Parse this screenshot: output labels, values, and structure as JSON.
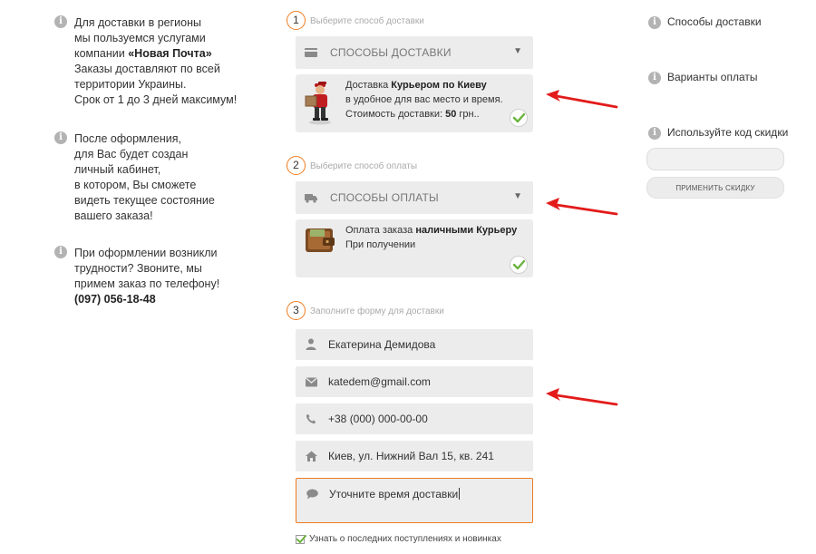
{
  "left_info": {
    "delivery": {
      "line1": "Для доставки в регионы",
      "line2": "мы пользуемся услугами",
      "line3_pre": "компании ",
      "line3_bold": "«Новая Почта»",
      "line4": "Заказы доставляют по всей",
      "line5": "территории Украины.",
      "line6": "Срок от 1 до 3 дней максимум!"
    },
    "account": {
      "line1": "После оформления,",
      "line2": "для Вас будет создан",
      "line3": "личный кабинет,",
      "line4": "в котором, Вы сможете",
      "line5": "видеть текущее состояние",
      "line6": "вашего заказа!"
    },
    "help": {
      "line1": "При оформлении возникли",
      "line2": "трудности? Звоните, мы",
      "line3": "примем заказ по телефону!",
      "phone": "(097) 056-18-48"
    }
  },
  "steps": [
    {
      "number": "1",
      "label": "Выберите способ доставки"
    },
    {
      "number": "2",
      "label": "Выберите способ оплаты"
    },
    {
      "number": "3",
      "label": "Заполните форму для доставки"
    }
  ],
  "delivery": {
    "select_label": "СПОСОБЫ ДОСТАВКИ",
    "option_pre": "Доставка ",
    "option_bold": "Курьером по Киеву",
    "option_line2": "в удобное для вас место и время.",
    "cost_pre": "Стоимость доставки: ",
    "cost_bold": "50",
    "cost_post": " грн.."
  },
  "payment": {
    "select_label": "СПОСОБЫ ОПЛАТЫ",
    "option_pre": "Оплата заказа ",
    "option_bold": "наличными Курьеру",
    "option_line2": "При получении"
  },
  "form": {
    "name": "Екатерина Демидова",
    "email": "katedem@gmail.com",
    "phone": "+38 (000) 000-00-00",
    "address": "Киев, ул. Нижний Вал 15, кв. 241",
    "comment": "Уточните время доставки",
    "newsletter_label": "Узнать о последних поступлениях и новинках",
    "newsletter_checked": true
  },
  "right_panel": {
    "delivery_methods": "Способы доставки",
    "payment_options": "Варианты оплаты",
    "discount_label": "Используйте код скидки",
    "discount_value": "",
    "apply_button": "ПРИМЕНИТЬ СКИДКУ"
  },
  "colors": {
    "accent": "#f07b1e",
    "arrow": "#e31b1b",
    "check": "#6cb33e"
  }
}
